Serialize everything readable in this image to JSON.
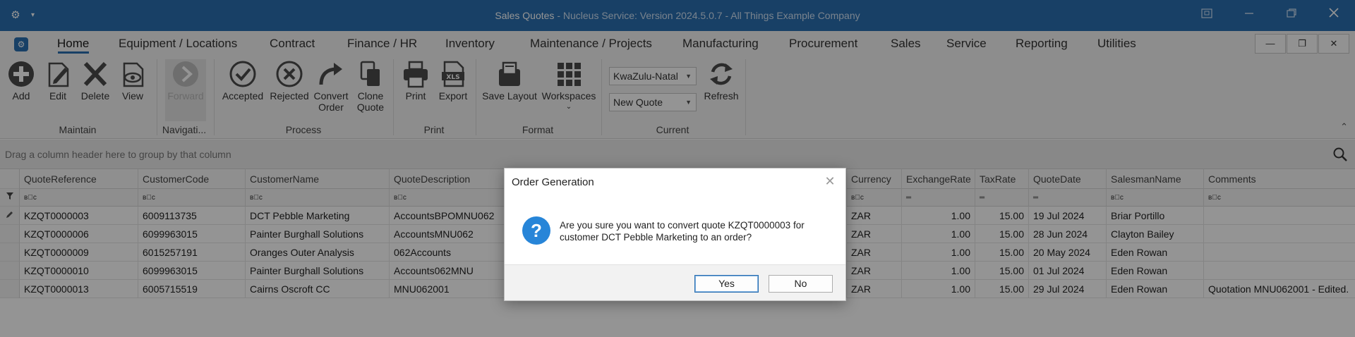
{
  "window": {
    "title_main": "Sales Quotes",
    "title_rest": " - Nucleus Service: Version 2024.5.0.7 - All Things Example Company",
    "gear_glyph": "⚙",
    "caret_glyph": "▾"
  },
  "menu": {
    "items": [
      "Home",
      "Equipment / Locations",
      "Contract",
      "Finance / HR",
      "Inventory",
      "Maintenance / Projects",
      "Manufacturing",
      "Procurement",
      "Sales",
      "Service",
      "Reporting",
      "Utilities"
    ]
  },
  "ribbon": {
    "buttons": {
      "add": "Add",
      "edit": "Edit",
      "delete": "Delete",
      "view": "View",
      "forward": "Forward",
      "accepted": "Accepted",
      "rejected": "Rejected",
      "convert_order_1": "Convert",
      "convert_order_2": "Order",
      "clone_quote_1": "Clone",
      "clone_quote_2": "Quote",
      "print": "Print",
      "export": "Export",
      "save_layout": "Save Layout",
      "workspaces": "Workspaces",
      "refresh": "Refresh"
    },
    "groups": {
      "maintain": "Maintain",
      "navigation": "Navigati...",
      "process": "Process",
      "print": "Print",
      "format": "Format",
      "current": "Current"
    },
    "region_select": "KwaZulu-Natal",
    "status_select": "New Quote"
  },
  "groupbar": {
    "placeholder": "Drag a column header here to group by that column"
  },
  "grid": {
    "columns": [
      "QuoteReference",
      "CustomerCode",
      "CustomerName",
      "QuoteDescription",
      "Currency",
      "ExchangeRate",
      "TaxRate",
      "QuoteDate",
      "SalesmanName",
      "Comments"
    ],
    "filter_abc": "ʙ⃞c",
    "filter_eq": "═",
    "rows": [
      {
        "ref": "KZQT0000003",
        "code": "6009113735",
        "name": "DCT Pebble Marketing",
        "desc": "AccountsBPOMNU062",
        "cur": "ZAR",
        "rate": "1.00",
        "tax": "15.00",
        "date": "19 Jul 2024",
        "sales": "Briar Portillo",
        "comments": ""
      },
      {
        "ref": "KZQT0000006",
        "code": "6099963015",
        "name": "Painter Burghall Solutions",
        "desc": "AccountsMNU062",
        "cur": "ZAR",
        "rate": "1.00",
        "tax": "15.00",
        "date": "28 Jun 2024",
        "sales": "Clayton Bailey",
        "comments": ""
      },
      {
        "ref": "KZQT0000009",
        "code": "6015257191",
        "name": "Oranges Outer Analysis",
        "desc": "062Accounts",
        "cur": "ZAR",
        "rate": "1.00",
        "tax": "15.00",
        "date": "20 May 2024",
        "sales": "Eden Rowan",
        "comments": ""
      },
      {
        "ref": "KZQT0000010",
        "code": "6099963015",
        "name": "Painter Burghall Solutions",
        "desc": "Accounts062MNU",
        "cur": "ZAR",
        "rate": "1.00",
        "tax": "15.00",
        "date": "01 Jul 2024",
        "sales": "Eden Rowan",
        "comments": ""
      },
      {
        "ref": "KZQT0000013",
        "code": "6005715519",
        "name": "Cairns Oscroft CC",
        "desc": "MNU062001",
        "cur": "ZAR",
        "rate": "1.00",
        "tax": "15.00",
        "date": "29 Jul 2024",
        "sales": "Eden Rowan",
        "comments": "Quotation MNU062001 - Edited."
      }
    ]
  },
  "dialog": {
    "title": "Order Generation",
    "message_line1": "Are you sure you want to convert quote KZQT0000003 for",
    "message_line2": "customer DCT Pebble Marketing to an order?",
    "yes": "Yes",
    "no": "No",
    "icon_glyph": "?"
  },
  "colors": {
    "titlebar": "#2a6fb0",
    "accent": "#2785d8"
  }
}
